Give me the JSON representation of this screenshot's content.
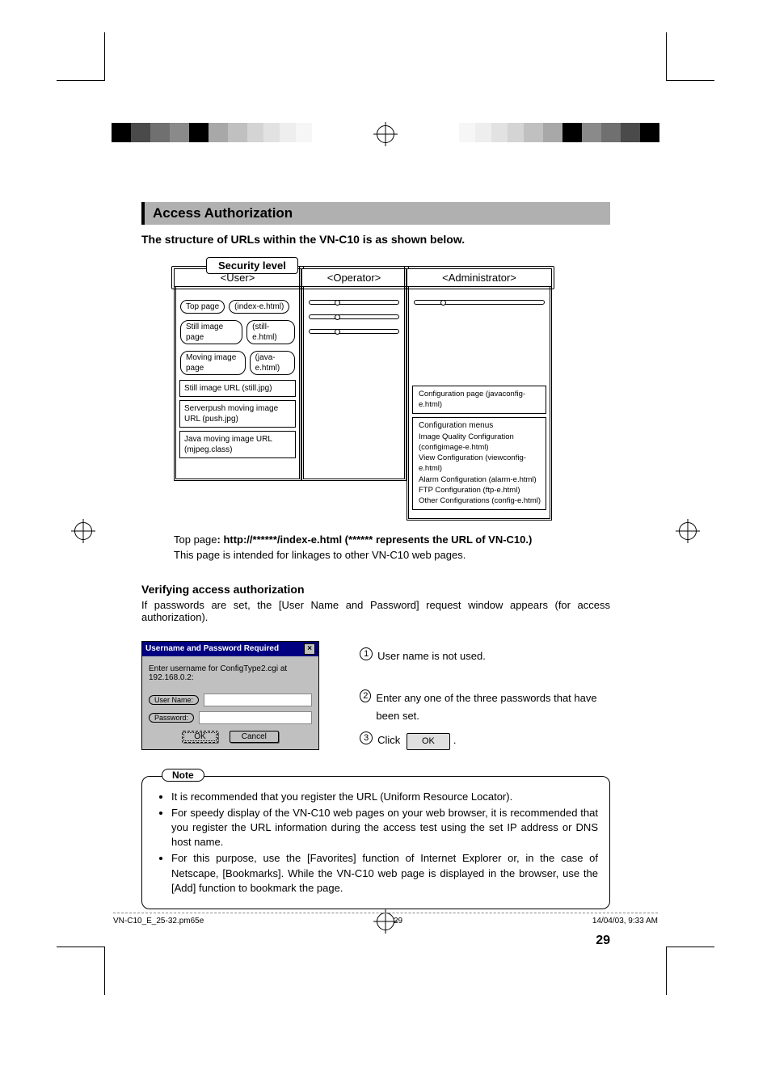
{
  "banner": "Access Authorization",
  "subtitle": "The structure of URLs within the VN-C10 is as shown below.",
  "diagram": {
    "security_label": "Security level",
    "roles": {
      "user": "<User>",
      "operator": "<Operator>",
      "admin": "<Administrator>"
    },
    "user_items": {
      "top_page": "Top page",
      "top_page_file": "(index-e.html)",
      "still_page": "Still image page",
      "still_page_file": "(still-e.html)",
      "moving_page": "Moving image page",
      "moving_page_file": "(java-e.html)",
      "still_url": "Still image URL (still.jpg)",
      "serverpush": "Serverpush moving image URL (push.jpg)",
      "java_url": "Java moving image URL (mjpeg.class)"
    },
    "admin_items": {
      "config_page": "Configuration page (javaconfig-e.html)",
      "menus_head": "Configuration menus",
      "m1": "Image Quality Configuration (configimage-e.html)",
      "m2": "View Configuration (viewconfig-e.html)",
      "m3": "Alarm Configuration (alarm-e.html)",
      "m4": "FTP Configuration (ftp-e.html)",
      "m5": "Other Configurations (config-e.html)"
    }
  },
  "caption": {
    "l1a": "Top page",
    "l1b": ": http://******/index-e.html (****** represents the URL of VN-C10.)",
    "l2": "This page is intended for linkages to other VN-C10 web pages."
  },
  "verify_head": "Verifying access authorization",
  "verify_para": "If passwords are set, the [User Name and Password] request window appears (for access authorization).",
  "dialog": {
    "title": "Username and Password Required",
    "prompt": "Enter username for ConfigType2.cgi at 192.168.0.2:",
    "user_label": "User Name:",
    "pass_label": "Password:",
    "ok": "OK",
    "cancel": "Cancel"
  },
  "annot": {
    "a1": "User name is not used.",
    "a2": "Enter any one of the three passwords that have been set.",
    "a3a": "Click",
    "a3b": "OK",
    "a3c": "."
  },
  "note": {
    "tag": "Note",
    "n1": "It is recommended that you register the URL (Uniform Resource Locator).",
    "n2": "For speedy display of the VN-C10 web pages on your web browser, it is recommended that you register the URL information during the access test using the set IP address or DNS host name.",
    "n3": "For this purpose, use the [Favorites] function of Internet Explorer or, in the case of Netscape, [Bookmarks]. While the VN-C10 web page is displayed in the browser, use the [Add] function to bookmark the page."
  },
  "page_number": "29",
  "footer": {
    "file": "VN-C10_E_25-32.pm65e",
    "page": "29",
    "date": "14/04/03, 9:33 AM"
  }
}
